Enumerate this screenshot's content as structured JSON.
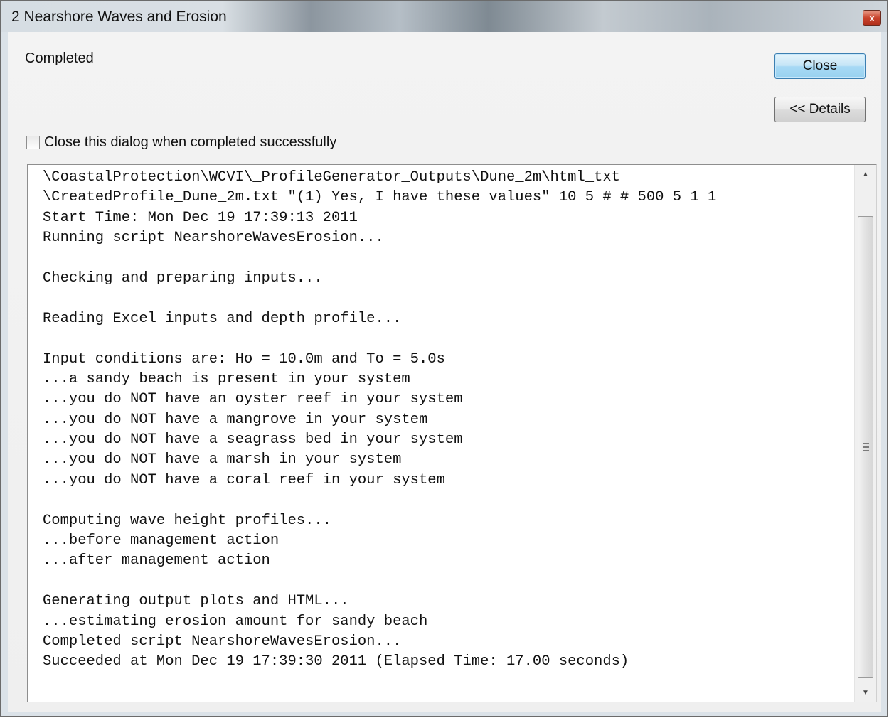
{
  "window": {
    "title": "2 Nearshore Waves and Erosion",
    "close_glyph": "x"
  },
  "status": {
    "text": "Completed"
  },
  "buttons": {
    "close_label": "Close",
    "details_label": "<< Details"
  },
  "option": {
    "close_on_success_label": "Close this dialog when completed successfully",
    "close_on_success_checked": false
  },
  "log": {
    "lines": [
      "\\CoastalProtection\\WCVI\\_ProfileGenerator_Outputs\\Dune_2m\\html_txt",
      "\\CreatedProfile_Dune_2m.txt \"(1) Yes, I have these values\" 10 5 # # 500 5 1 1",
      "Start Time: Mon Dec 19 17:39:13 2011",
      "Running script NearshoreWavesErosion...",
      "",
      "Checking and preparing inputs...",
      "",
      "Reading Excel inputs and depth profile...",
      "",
      "Input conditions are: Ho = 10.0m and To = 5.0s",
      "...a sandy beach is present in your system",
      "...you do NOT have an oyster reef in your system",
      "...you do NOT have a mangrove in your system",
      "...you do NOT have a seagrass bed in your system",
      "...you do NOT have a marsh in your system",
      "...you do NOT have a coral reef in your system",
      "",
      "Computing wave height profiles...",
      "...before management action",
      "...after management action",
      "",
      "Generating output plots and HTML...",
      "...estimating erosion amount for sandy beach",
      "Completed script NearshoreWavesErosion...",
      "Succeeded at Mon Dec 19 17:39:30 2011 (Elapsed Time: 17.00 seconds)"
    ]
  },
  "icons": {
    "window_close": "close-icon",
    "scroll_up": "scroll-up-arrow-icon",
    "scroll_down": "scroll-down-arrow-icon",
    "scroll_grip": "scrollbar-grip-icon"
  }
}
